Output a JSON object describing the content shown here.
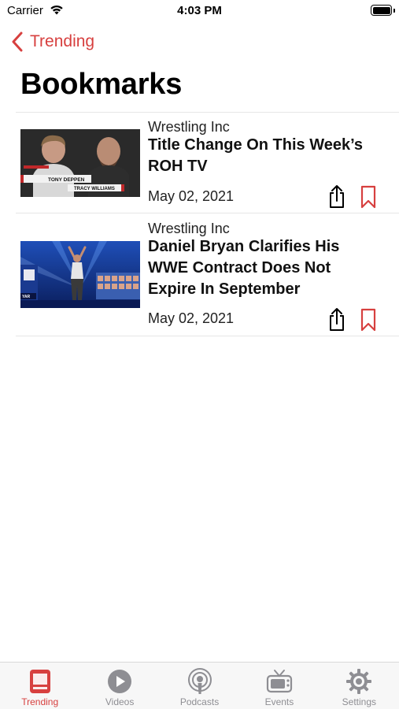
{
  "status_bar": {
    "carrier": "Carrier",
    "time": "4:03 PM"
  },
  "nav": {
    "back_label": "Trending"
  },
  "page": {
    "title": "Bookmarks"
  },
  "articles": [
    {
      "source": "Wrestling Inc",
      "title": "Title Change On This Week’s ROH TV",
      "date": "May 02, 2021",
      "thumbnail_caption_1": "TONY DEPPEN",
      "thumbnail_caption_2": "TRACY WILLIAMS",
      "bookmarked": true
    },
    {
      "source": "Wrestling Inc",
      "title": "Daniel Bryan Clarifies His WWE Contract Does Not Expire In September",
      "date": "May 02, 2021",
      "bookmarked": true
    }
  ],
  "tabs": [
    {
      "label": "Trending",
      "icon": "trending-icon",
      "active": true
    },
    {
      "label": "Videos",
      "icon": "play-icon",
      "active": false
    },
    {
      "label": "Podcasts",
      "icon": "podcast-icon",
      "active": false
    },
    {
      "label": "Events",
      "icon": "tv-icon",
      "active": false
    },
    {
      "label": "Settings",
      "icon": "gear-icon",
      "active": false
    }
  ],
  "colors": {
    "accent": "#d7403f",
    "inactive": "#8e8e93",
    "divider": "#e6e6e6"
  }
}
